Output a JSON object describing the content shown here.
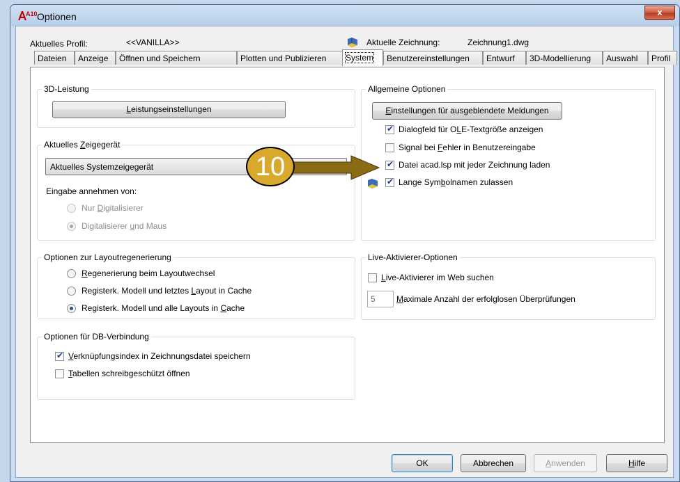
{
  "window": {
    "title": "Optionen",
    "app_icon": "A10",
    "close": "x"
  },
  "profile": {
    "label": "Aktuelles Profil:",
    "value": "<<VANILLA>>"
  },
  "drawing": {
    "label": "Aktuelle Zeichnung:",
    "value": "Zeichnung1.dwg"
  },
  "tabs": [
    "Dateien",
    "Anzeige",
    "Öffnen und Speichern",
    "Plotten und Publizieren",
    "System",
    "Benutzereinstellungen",
    "Entwurf",
    "3D-Modellierung",
    "Auswahl",
    "Profil"
  ],
  "active_tab": "System",
  "perf": {
    "title": "3D-Leistung",
    "button_pre": "",
    "button_u": "L",
    "button_post": "eistungseinstellungen"
  },
  "pointer": {
    "title_pre": "Aktuelles ",
    "title_u": "Z",
    "title_post": "eigegerät",
    "select_value": "Aktuelles Systemzeigegerät",
    "input_label": "Eingabe annehmen von:",
    "opt1_pre": "Nur ",
    "opt1_u": "D",
    "opt1_post": "igitalisierer",
    "opt2_pre": "Digitalisierer ",
    "opt2_u": "u",
    "opt2_post": "nd Maus"
  },
  "layout": {
    "title": "Optionen zur Layoutregenerierung",
    "opt1_pre": "",
    "opt1_u": "R",
    "opt1_post": "egenerierung beim Layoutwechsel",
    "opt2_pre": "Registerk. Modell und letztes ",
    "opt2_u": "L",
    "opt2_post": "ayout in Cache",
    "opt3_pre": "Registerk. Modell und alle Layouts in ",
    "opt3_u": "C",
    "opt3_post": "ache"
  },
  "db": {
    "title": "Optionen für DB-Verbindung",
    "opt1_pre": "",
    "opt1_u": "V",
    "opt1_post": "erknüpfungsindex in Zeichnungsdatei speichern",
    "opt2_pre": "",
    "opt2_u": "T",
    "opt2_post": "abellen schreibgeschützt öffnen"
  },
  "general": {
    "title": "Allgemeine Optionen",
    "button_pre": "",
    "button_u": "E",
    "button_post": "instellungen für ausgeblendete Meldungen",
    "opt1_pre": "Dialogfeld für O",
    "opt1_u": "L",
    "opt1_post": "E-Textgröße anzeigen",
    "opt2_pre": "Signal bei ",
    "opt2_u": "F",
    "opt2_post": "ehler in Benutzereingabe",
    "opt3_pre": "Datei acad.lsp mit ",
    "opt3_u": "j",
    "opt3_post": "eder Zeichnung laden",
    "opt4_pre": "Lange Sym",
    "opt4_u": "b",
    "opt4_post": "olnamen zulassen"
  },
  "live": {
    "title": "Live-Aktivierer-Optionen",
    "opt1_pre": "",
    "opt1_u": "L",
    "opt1_post": "ive-Aktivierer im Web suchen",
    "count": "5",
    "count_label_pre": "",
    "count_label_u": "M",
    "count_label_post": "aximale Anzahl der erfolglosen Überprüfungen"
  },
  "buttons": {
    "ok": "OK",
    "cancel": "Abbrechen",
    "apply_pre": "",
    "apply_u": "A",
    "apply_post": "nwenden",
    "help_pre": "",
    "help_u": "H",
    "help_post": "ilfe"
  },
  "annotation": {
    "number": "10",
    "color": "#8b6b14"
  }
}
